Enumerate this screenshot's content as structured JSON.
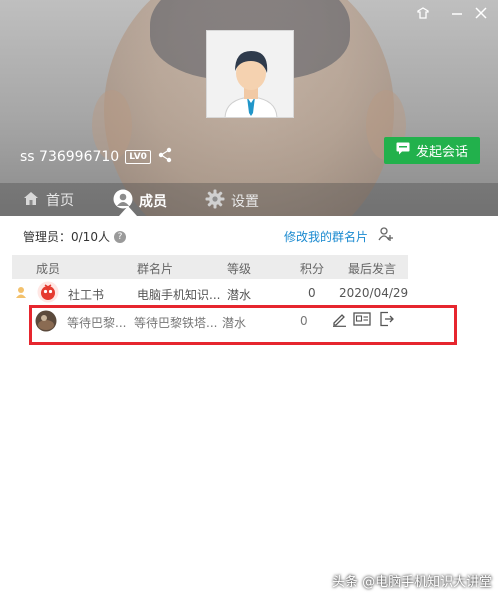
{
  "header": {
    "username": "ss 736996710",
    "level_badge": "LV0",
    "start_chat_label": "发起会话"
  },
  "tabs": [
    {
      "label": "首页",
      "icon": "home-icon",
      "active": false
    },
    {
      "label": "成员",
      "icon": "member-icon",
      "active": true
    },
    {
      "label": "设置",
      "icon": "gear-icon",
      "active": false
    }
  ],
  "members": {
    "admin_count": "管理员：0/10人",
    "edit_card_label": "修改我的群名片",
    "columns": [
      "成员",
      "群名片",
      "等级",
      "积分",
      "最后发言"
    ],
    "rows": [
      {
        "name": "社工书",
        "card": "电脑手机知识...",
        "level": "潜水",
        "points": "0",
        "last": "2020/04/29"
      },
      {
        "name": "等待巴黎...",
        "card": "等待巴黎铁塔...",
        "level": "潜水",
        "points": "0",
        "last": ""
      }
    ]
  },
  "watermark": "头条 @电脑手机知识大讲堂",
  "colors": {
    "accent_green": "#22b14c",
    "link_blue": "#1a8ad0",
    "highlight_red": "#e6262e"
  }
}
